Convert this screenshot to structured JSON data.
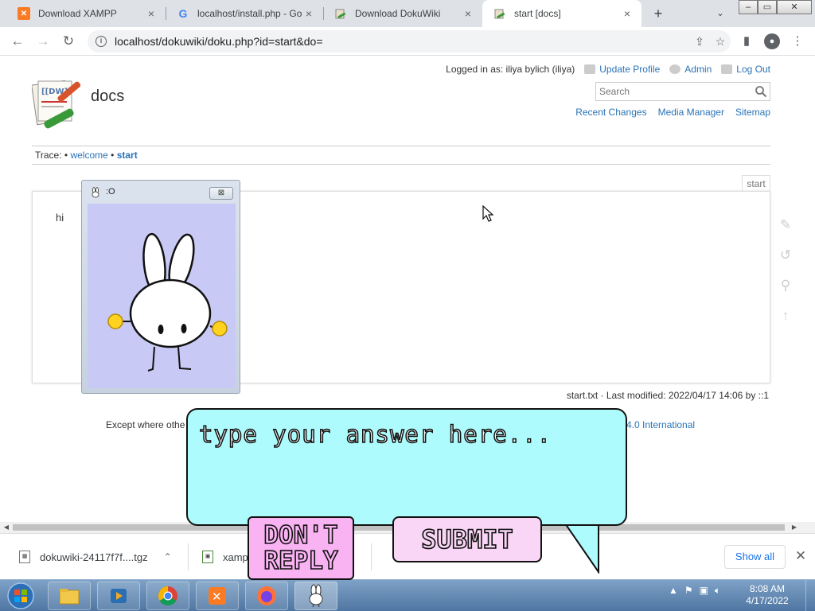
{
  "browser": {
    "tabs": [
      {
        "title": "Download XAMPP",
        "favicon": "xampp-icon"
      },
      {
        "title": "localhost/install.php - Go",
        "favicon": "google-icon"
      },
      {
        "title": "Download DokuWiki",
        "favicon": "dokuwiki-icon"
      },
      {
        "title": "start [docs]",
        "favicon": "dokuwiki-icon",
        "active": true
      }
    ],
    "new_tab": "+",
    "tab_menu": "⌄",
    "url": "localhost/dokuwiki/doku.php?id=start&do="
  },
  "wiki": {
    "user_label": "Logged in as: iliya bylich (iliya)",
    "user_links": [
      "Update Profile",
      "Admin",
      "Log Out"
    ],
    "site_title": "docs",
    "search_placeholder": "Search",
    "site_tools": [
      "Recent Changes",
      "Media Manager",
      "Sitemap"
    ],
    "trace_label": "Trace:",
    "trace_sep": "•",
    "trace": [
      "welcome",
      "start"
    ],
    "page_id": "start",
    "content_text": "hi",
    "docinfo": "start.txt · Last modified: 2022/04/17 14:06 by ::1",
    "license_left": "Except where othe",
    "license_right": "4.0 International"
  },
  "downloads": {
    "items": [
      {
        "name": "dokuwiki-24117f7f....tgz"
      },
      {
        "name": "xamp"
      }
    ],
    "show_all": "Show all"
  },
  "taskbar": {
    "time": "8:08 AM",
    "date": "4/17/2022"
  },
  "popup": {
    "title": ":O"
  },
  "bubble": {
    "prompt": "type your answer here...",
    "dont_reply": "DON'T REPLY",
    "submit": "SUBMIT"
  },
  "colors": {
    "bubble_fill": "#adfbfc",
    "dont_reply_fill": "#f9b3f3",
    "submit_fill": "#fad6f6",
    "popup_bg": "#c8c9f5",
    "link": "#2b73b7"
  }
}
